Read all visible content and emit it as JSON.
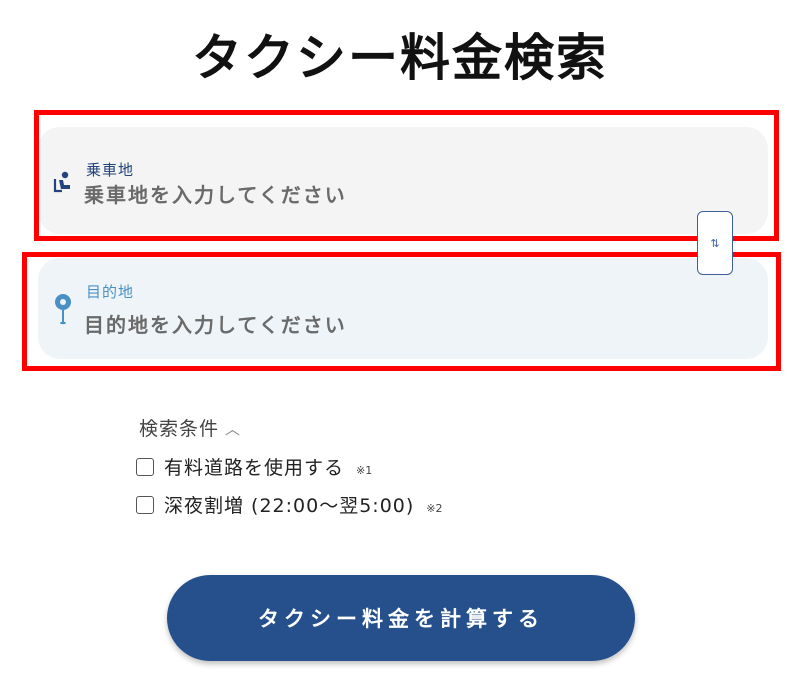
{
  "page": {
    "title": "タクシー料金検索"
  },
  "origin": {
    "label": "乗車地",
    "placeholder": "乗車地を入力してください",
    "icon": "seat-person-icon"
  },
  "destination": {
    "label": "目的地",
    "placeholder": "目的地を入力してください",
    "icon": "map-pin-icon"
  },
  "swap": {
    "icon": "swap-arrows-icon"
  },
  "conditions": {
    "toggle_label": "検索条件",
    "toggle_icon": "chevron-up-icon",
    "options": [
      {
        "label": "有料道路を使用する",
        "note": "※1",
        "checked": false
      },
      {
        "label": "深夜割増 (22:00～翌5:00)",
        "note": "※2",
        "checked": false
      }
    ]
  },
  "submit": {
    "label": "タクシー料金を計算する"
  },
  "colors": {
    "primary": "#26508c",
    "origin_label": "#23437a",
    "destination_label": "#4a90c4",
    "highlight": "#ff0000"
  }
}
